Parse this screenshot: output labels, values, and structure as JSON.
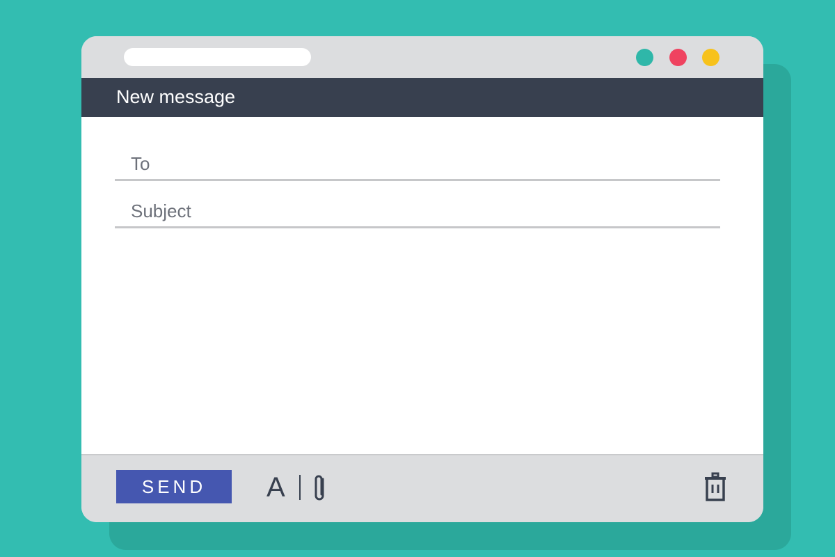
{
  "window": {
    "title": "New message"
  },
  "traffic_lights": [
    {
      "name": "teal",
      "color": "#2fb7a9"
    },
    {
      "name": "red",
      "color": "#ef4360"
    },
    {
      "name": "yellow",
      "color": "#f7c21c"
    }
  ],
  "form": {
    "to_placeholder": "To",
    "subject_placeholder": "Subject"
  },
  "footer": {
    "send_label": "SEND",
    "format_label": "A",
    "icons": [
      "format-text-icon",
      "paperclip-icon",
      "trash-icon"
    ]
  }
}
